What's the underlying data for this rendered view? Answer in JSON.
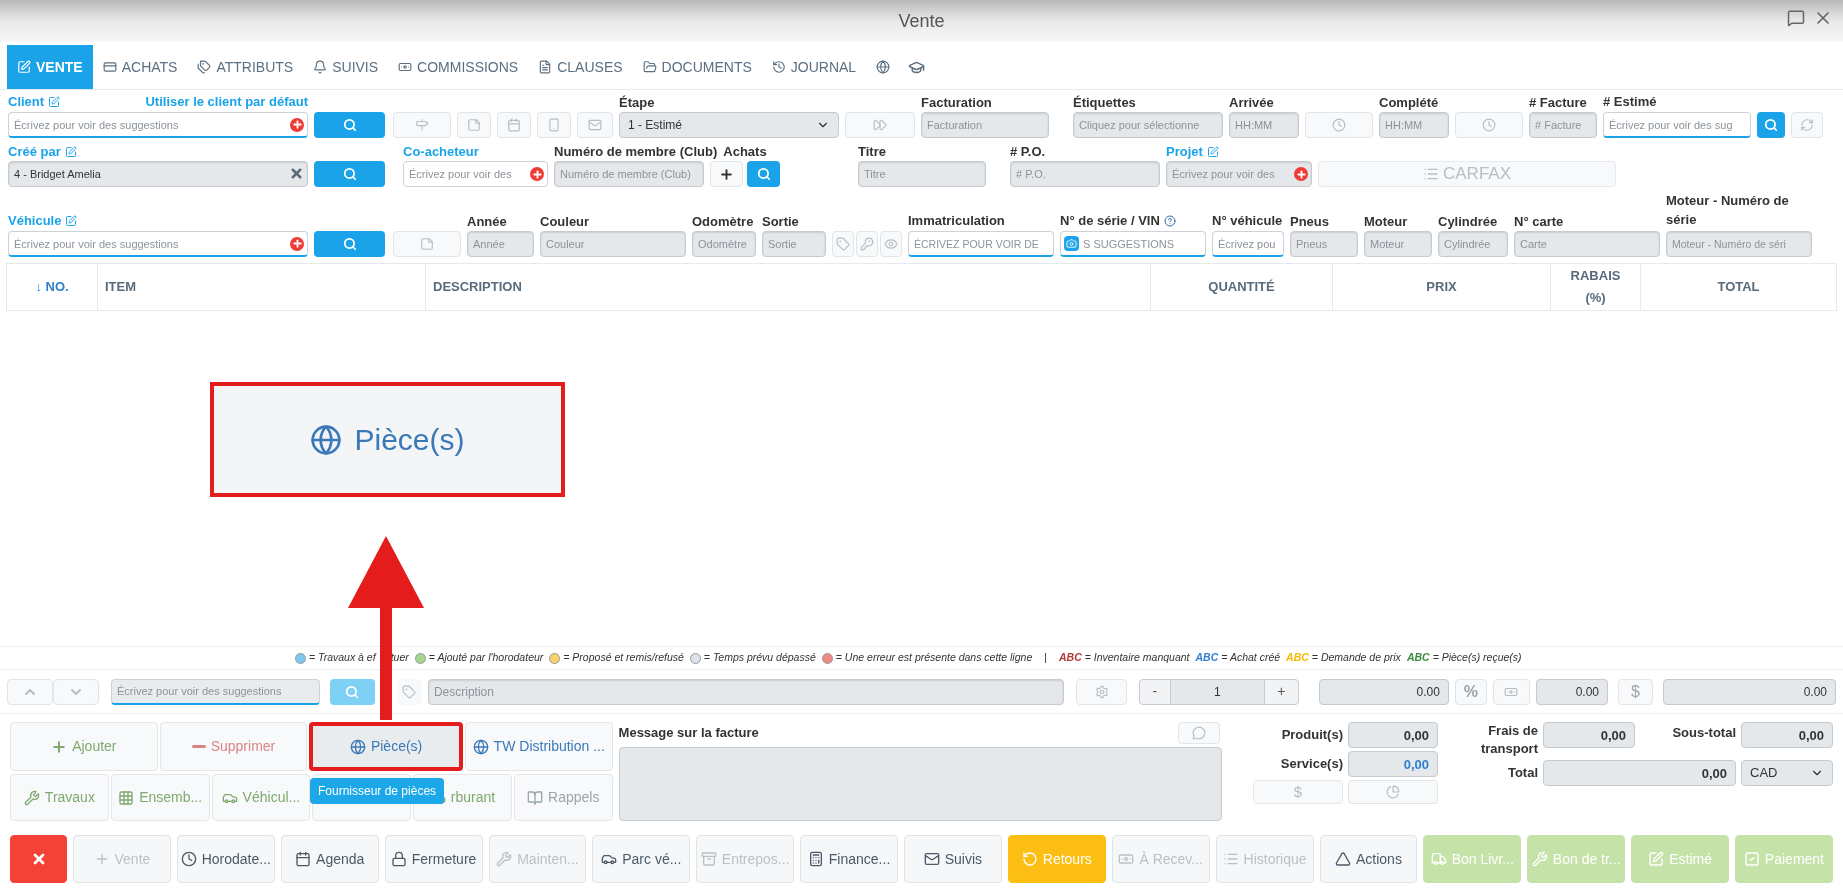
{
  "window": {
    "title": "Vente"
  },
  "tabs": [
    {
      "label": "VENTE",
      "selected": true
    },
    {
      "label": "ACHATS",
      "selected": false
    },
    {
      "label": "ATTRIBUTS",
      "selected": false
    },
    {
      "label": "SUIVIS",
      "selected": false
    },
    {
      "label": "COMMISSIONS",
      "selected": false
    },
    {
      "label": "CLAUSES",
      "selected": false
    },
    {
      "label": "DOCUMENTS",
      "selected": false
    },
    {
      "label": "JOURNAL",
      "selected": false
    }
  ],
  "form": {
    "client": {
      "label": "Client",
      "default_link": "Utiliser le client par défaut",
      "placeholder": "Écrivez pour voir des suggestions"
    },
    "etape": {
      "label": "Étape",
      "value": "1 - Estimé"
    },
    "facturation": {
      "label": "Facturation",
      "placeholder": "Facturation"
    },
    "etiquettes": {
      "label": "Étiquettes",
      "placeholder": "Cliquez pour sélectionne"
    },
    "arrivee": {
      "label": "Arrivée",
      "placeholder": "HH:MM"
    },
    "complete": {
      "label": "Complété",
      "placeholder": "HH:MM"
    },
    "facture": {
      "label": "# Facture",
      "placeholder": "# Facture"
    },
    "estime": {
      "label": "# Estimé",
      "placeholder": "Écrivez pour voir des sug"
    },
    "cree_par": {
      "label": "Créé par",
      "value": "4 - Bridget Amelia"
    },
    "coacheteur": {
      "label": "Co-acheteur",
      "placeholder": "Écrivez pour voir des"
    },
    "membre": {
      "label": "Numéro de membre (Club)",
      "placeholder": "Numéro de membre (Club)"
    },
    "achats": {
      "label": "Achats"
    },
    "titre": {
      "label": "Titre",
      "placeholder": "Titre"
    },
    "po": {
      "label": "# P.O.",
      "placeholder": "# P.O."
    },
    "projet": {
      "label": "Projet",
      "placeholder": "Écrivez pour voir des"
    },
    "carfax": {
      "label": "CARFAX"
    },
    "vehicule": {
      "label": "Véhicule",
      "placeholder": "Écrivez pour voir des suggestions"
    },
    "annee": {
      "label": "Année",
      "placeholder": "Année"
    },
    "couleur": {
      "label": "Couleur",
      "placeholder": "Couleur"
    },
    "odometre": {
      "label": "Odomètre",
      "placeholder": "Odomètre"
    },
    "sortie": {
      "label": "Sortie",
      "placeholder": "Sortie"
    },
    "immatriculation": {
      "label": "Immatriculation",
      "placeholder": "ÉCRIVEZ POUR VOIR DE"
    },
    "vin": {
      "label": "N° de série / VIN",
      "placeholder": "S SUGGESTIONS"
    },
    "no_vehicule": {
      "label": "N° véhicule",
      "placeholder": "Écrivez pou"
    },
    "pneus": {
      "label": "Pneus",
      "placeholder": "Pneus"
    },
    "moteur": {
      "label": "Moteur",
      "placeholder": "Moteur"
    },
    "cylindree": {
      "label": "Cylindrée",
      "placeholder": "Cylindrée"
    },
    "carte": {
      "label": "N° carte",
      "placeholder": "Carte"
    },
    "moteur_serie": {
      "label": "Moteur - Numéro de série",
      "placeholder": "Moteur - Numéro de séri"
    }
  },
  "table": {
    "columns": [
      "↓ NO.",
      "ITEM",
      "DESCRIPTION",
      "QUANTITÉ",
      "PRIX",
      "RABAIS (%)",
      "TOTAL"
    ]
  },
  "annotation": {
    "label": "Pièce(s)"
  },
  "legend": {
    "dots": [
      {
        "color": "#7cc8f0",
        "text": "= Travaux à ef",
        "text_after": "tuer"
      },
      {
        "color": "#a9d68f",
        "text": "= Ajouté par l'horodateur"
      },
      {
        "color": "#f6d36b",
        "text": "= Proposé et remis/refusé"
      },
      {
        "color": "#dde3e8",
        "text": "= Temps prévu dépassé"
      },
      {
        "color": "#f08a84",
        "text": "= Une erreur est présente dans cette ligne"
      }
    ],
    "separator": "|",
    "codes": [
      {
        "color": "#b03a3a",
        "code": "ABC",
        "text": "= Inventaire manquant"
      },
      {
        "color": "#2f7fd0",
        "code": "ABC",
        "text": "= Achat créé"
      },
      {
        "color": "#f5b800",
        "code": "ABC",
        "text": "= Demande de prix"
      },
      {
        "color": "#3d8b3d",
        "code": "ABC",
        "text": "= Pièce(s) reçue(s)"
      }
    ]
  },
  "line_entry": {
    "placeholder": "Écrivez pour voir des suggestions",
    "description": {
      "placeholder": "Description"
    },
    "minus": "-",
    "quantity": "1",
    "plus": "+",
    "price": "0.00",
    "percent": "%",
    "discount": "0.00",
    "dollar": "$",
    "total": "0.00"
  },
  "actions_row1": [
    {
      "label": "Ajouter",
      "color": "#7fa96e",
      "highlighted": false
    },
    {
      "label": "Supprimer",
      "color": "#d98585",
      "highlighted": false
    },
    {
      "label": "Pièce(s)",
      "color": "#3b78b8",
      "highlighted": true
    },
    {
      "label": "TW Distribution ...",
      "color": "#3b78b8",
      "highlighted": false
    }
  ],
  "actions_row2": [
    {
      "kind": "button",
      "label": "Travaux",
      "color": "#7fa96e"
    },
    {
      "kind": "button",
      "label": "Ensemb...",
      "color": "#7fa96e"
    },
    {
      "kind": "button",
      "label": "Véhicul...",
      "color": "#7fa96e"
    },
    {
      "kind": "covered"
    },
    {
      "kind": "button",
      "label": "rburant",
      "color": "#7fa96e"
    },
    {
      "kind": "button",
      "label": "Rappels",
      "color": "#9aa5ae"
    }
  ],
  "tooltip": "Fournisseur de pièces",
  "message": {
    "label": "Message sur la facture"
  },
  "totals": {
    "produits": {
      "label": "Produit(s)",
      "value": "0,00"
    },
    "services": {
      "label": "Service(s)",
      "value": "0,00"
    },
    "frais": {
      "label": "Frais de transport",
      "value": "0,00"
    },
    "sous_total": {
      "label": "Sous-total",
      "value": "0,00"
    },
    "total": {
      "label": "Total",
      "value": "0,00"
    },
    "currency": "CAD",
    "dollar": "$"
  },
  "footer_buttons": [
    {
      "kind": "danger",
      "disabled": false
    },
    {
      "label": "Vente",
      "kind": "default",
      "disabled": true
    },
    {
      "label": "Horodate...",
      "kind": "default",
      "disabled": false
    },
    {
      "label": "Agenda",
      "kind": "default",
      "disabled": false
    },
    {
      "label": "Fermeture",
      "kind": "default",
      "disabled": false
    },
    {
      "label": "Mainten...",
      "kind": "default",
      "disabled": true
    },
    {
      "label": "Parc vé...",
      "kind": "default",
      "disabled": false
    },
    {
      "label": "Entrepos...",
      "kind": "default",
      "disabled": true
    },
    {
      "label": "Finance...",
      "kind": "default",
      "disabled": false
    },
    {
      "label": "Suivis",
      "kind": "default",
      "disabled": false
    },
    {
      "label": "Retours",
      "kind": "warning",
      "disabled": false
    },
    {
      "label": "À Recev...",
      "kind": "default",
      "disabled": true
    },
    {
      "label": "Historique",
      "kind": "default",
      "disabled": true
    },
    {
      "label": "Actions",
      "kind": "default",
      "disabled": false
    },
    {
      "label": "Bon Livr...",
      "kind": "success",
      "disabled": false
    },
    {
      "label": "Bon de tr...",
      "kind": "success",
      "disabled": false
    },
    {
      "label": "Estimé",
      "kind": "success",
      "disabled": false
    },
    {
      "label": "Paiement",
      "kind": "success",
      "disabled": false
    }
  ]
}
